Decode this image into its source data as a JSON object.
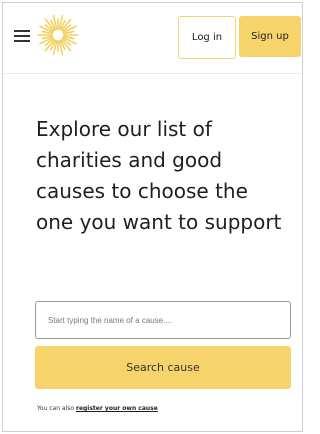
{
  "header": {
    "menu_icon": "hamburger-menu-icon",
    "logo_icon": "sunburst-logo",
    "login_label": "Log in",
    "signup_label": "Sign up"
  },
  "main": {
    "heading": "Explore our list of charities and good causes to choose the one you want to support",
    "search": {
      "placeholder": "Start typing the name of a cause....",
      "value": "",
      "button_label": "Search cause"
    },
    "footnote": {
      "prefix": "You can also ",
      "link_label": "register your own cause"
    }
  },
  "colors": {
    "accent": "#f6d36b",
    "button_outline": "#f2d675",
    "text": "#1f1f1f"
  }
}
